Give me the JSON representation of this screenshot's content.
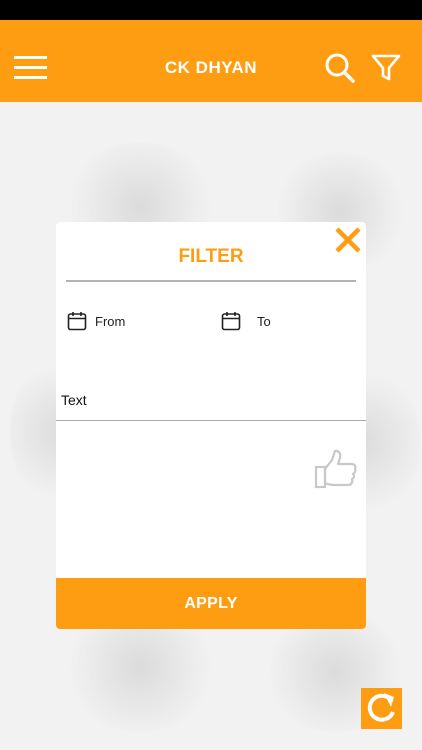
{
  "app_bar": {
    "title": "CK DHYAN",
    "menu_icon": "hamburger-menu-icon",
    "search_icon": "search-icon",
    "filter_icon": "filter-funnel-icon"
  },
  "filter_dialog": {
    "title": "FILTER",
    "close_icon": "close-icon",
    "from_label": "From",
    "to_label": "To",
    "calendar_icon": "calendar-icon",
    "text_label": "Text",
    "like_icon": "thumbs-up-icon",
    "apply_label": "APPLY"
  },
  "refresh_icon": "refresh-icon",
  "colors": {
    "accent": "#ff9d12",
    "divider": "#b3b3b3"
  }
}
